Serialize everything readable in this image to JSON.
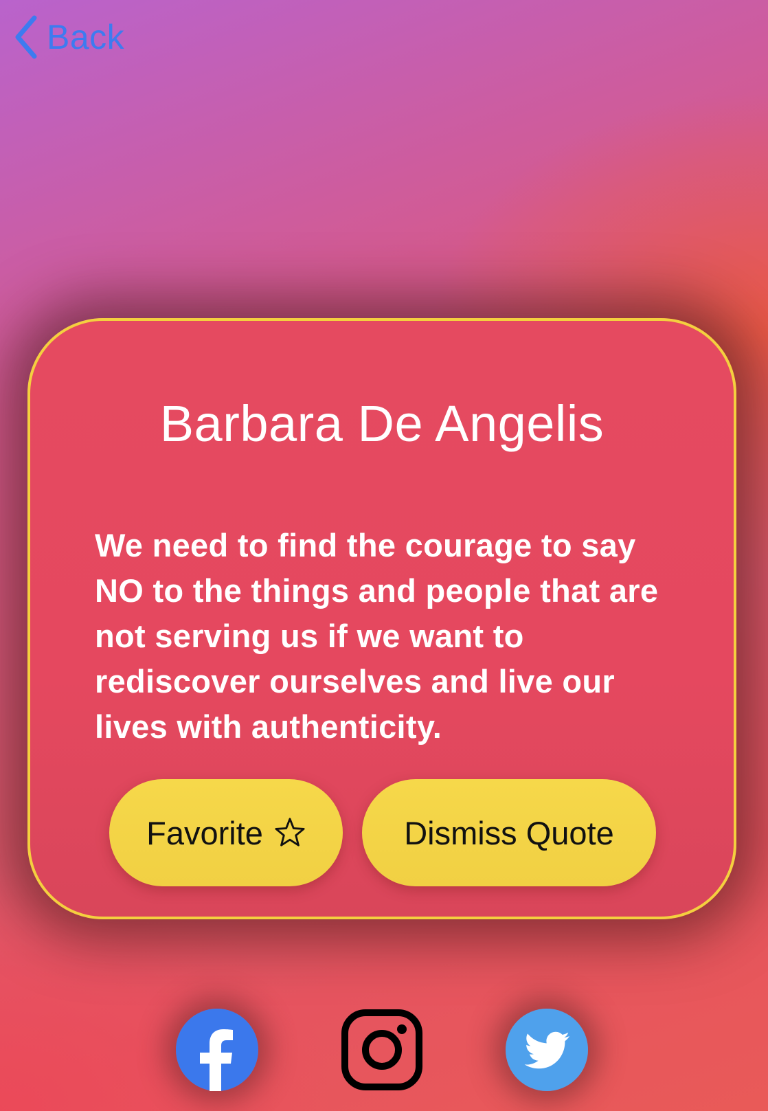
{
  "nav": {
    "back_label": "Back"
  },
  "quote_card": {
    "author": "Barbara De Angelis",
    "text": "We need to find the courage to say NO to the things and people that are not serving us if we want to rediscover ourselves and live our lives with authenticity.",
    "favorite_label": "Favorite",
    "dismiss_label": "Dismiss Quote"
  },
  "social": {
    "icons": [
      "facebook-icon",
      "instagram-icon",
      "twitter-icon"
    ]
  },
  "colors": {
    "card_border": "#f4d03f",
    "card_fill": "#e54a60",
    "button_fill": "#f6d84a",
    "link_blue": "#3d7bf0",
    "facebook_blue": "#3b78ec",
    "twitter_blue": "#4fa1ec"
  }
}
